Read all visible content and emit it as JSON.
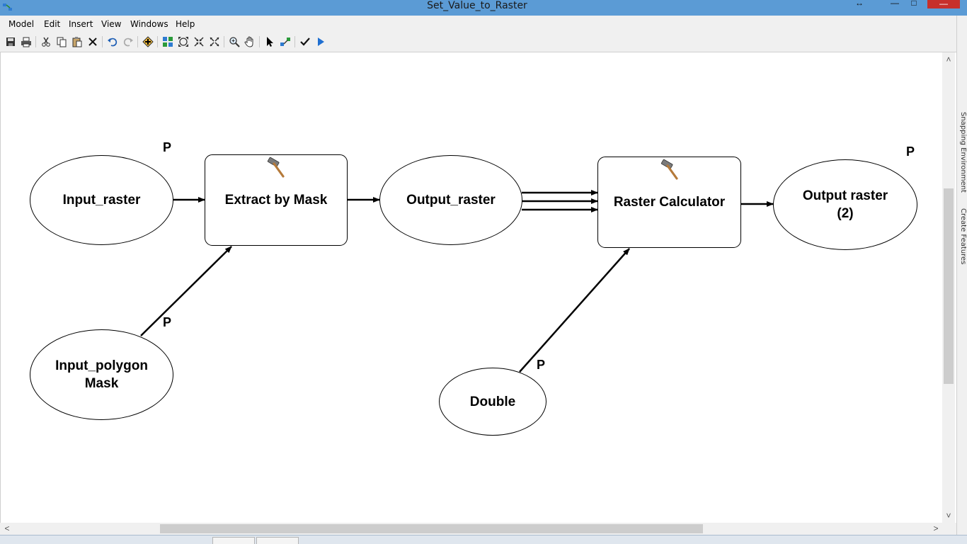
{
  "window": {
    "title": "Set_Value_to_Raster"
  },
  "menu": {
    "items": [
      "Model",
      "Edit",
      "Insert",
      "View",
      "Windows",
      "Help"
    ]
  },
  "toolbar": {
    "buttons": [
      "save-icon",
      "print-icon",
      "cut-icon",
      "copy-icon",
      "paste-icon",
      "delete-icon",
      "undo-icon",
      "redo-icon",
      "add-data-icon",
      "auto-layout-icon",
      "full-extent-icon",
      "fixed-zoom-in-icon",
      "fixed-zoom-out-icon",
      "zoom-in-icon",
      "pan-icon",
      "select-icon",
      "connect-icon",
      "validate-icon",
      "run-icon"
    ]
  },
  "side_panel": {
    "tabs": [
      "Snapping Environment",
      "Create Features"
    ]
  },
  "diagram": {
    "nodes": {
      "input_raster": "Input_raster",
      "extract_by_mask": "Extract by Mask",
      "output_raster": "Output_raster",
      "raster_calculator": "Raster Calculator",
      "output_raster_2": "Output raster\n(2)",
      "input_polygon_mask": "Input_polygon\nMask",
      "double": "Double"
    },
    "parameter_marker": "P"
  },
  "colors": {
    "title_bar": "#5b9bd5",
    "close_button": "#c7302b",
    "chrome": "#f0f0f0",
    "run_icon": "#1f6fd1"
  }
}
